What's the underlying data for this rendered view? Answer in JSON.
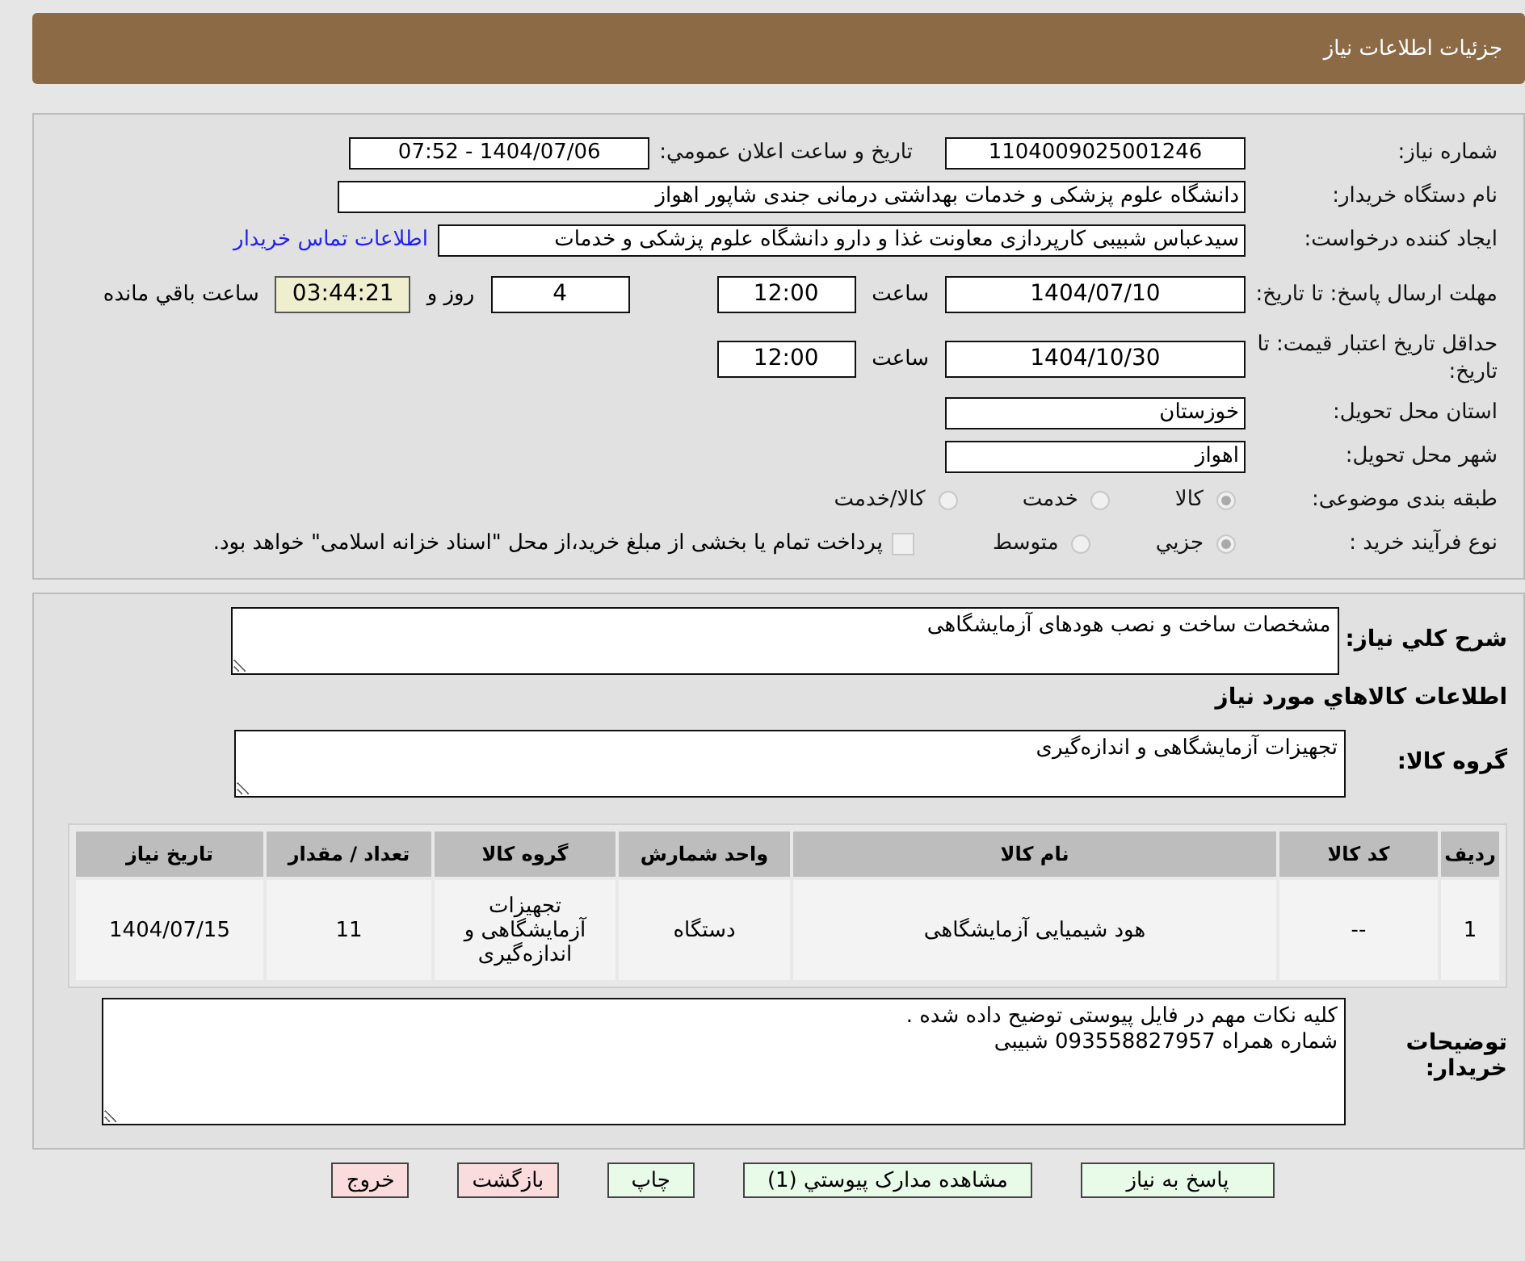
{
  "header": {
    "title": "جزئیات اطلاعات نیاز"
  },
  "details": {
    "need_number": {
      "label": "شماره نیاز:",
      "value": "1104009025001246"
    },
    "announce": {
      "label": "تاریخ و ساعت اعلان عمومي:",
      "value": "1404/07/06 - 07:52"
    },
    "buyer": {
      "label": "نام دستگاه خریدار:",
      "value": "دانشگاه علوم پزشکی و خدمات بهداشتی درمانی جندی شاپور اهواز"
    },
    "requester": {
      "label": "ایجاد کننده درخواست:",
      "value": "سیدعباس شبیبی کارپردازی معاونت غذا و دارو دانشگاه علوم پزشکی و خدمات",
      "link": "اطلاعات تماس خریدار"
    },
    "deadline": {
      "label": "مهلت ارسال پاسخ: تا تاریخ:",
      "date": "1404/07/10",
      "time_label": "ساعت",
      "time": "12:00",
      "days": "4",
      "days_label": "روز و",
      "remaining": "03:44:21",
      "remaining_label": "ساعت باقي مانده"
    },
    "validity": {
      "label": "حداقل تاریخ اعتبار قیمت: تا تاریخ:",
      "date": "1404/10/30",
      "time_label": "ساعت",
      "time": "12:00"
    },
    "province": {
      "label": "استان محل تحویل:",
      "value": "خوزستان"
    },
    "city": {
      "label": "شهر محل تحویل:",
      "value": "اهواز"
    },
    "category": {
      "label": "طبقه بندی موضوعی:",
      "options": [
        {
          "label": "کالا",
          "selected": true
        },
        {
          "label": "خدمت",
          "selected": false
        },
        {
          "label": "کالا/خدمت",
          "selected": false
        }
      ]
    },
    "process": {
      "label": "نوع فرآیند خرید :",
      "options": [
        {
          "label": "جزيي",
          "selected": true
        },
        {
          "label": "متوسط",
          "selected": false
        }
      ],
      "payment": {
        "label": "پرداخت تمام یا بخشی از مبلغ خرید،از محل \"اسناد خزانه اسلامی\" خواهد بود.",
        "checked": false
      }
    }
  },
  "goods": {
    "description": {
      "label": "شرح کلي نیاز:",
      "value": "مشخصات ساخت و نصب هودهای آزمایشگاهی"
    },
    "heading": "اطلاعات کالاهاي مورد نیاز",
    "group": {
      "label": "گروه کالا:",
      "value": "تجهیزات آزمایشگاهی و اندازه‌گیری"
    },
    "table": {
      "columns": [
        "ردیف",
        "کد کالا",
        "نام کالا",
        "واحد شمارش",
        "گروه کالا",
        "تعداد / مقدار",
        "تاریخ نیاز"
      ],
      "rows": [
        [
          "1",
          "--",
          "هود شیمیایی آزمایشگاهی",
          "دستگاه",
          "تجهیزات آزمایشگاهی و اندازه‌گیری",
          "11",
          "1404/07/15"
        ]
      ]
    },
    "notes": {
      "label": "توضیحات خریدار:",
      "lines": [
        "کلیه نکات مهم در فایل پیوستی توضیح داده شده .",
        "شماره همراه 093558827957 شبیبی"
      ]
    }
  },
  "buttons": [
    {
      "label": "پاسخ به نیاز",
      "kind": "ok"
    },
    {
      "label": "مشاهده مدارک پیوستي (1)",
      "kind": "ok"
    },
    {
      "label": "چاپ",
      "kind": "ok"
    },
    {
      "label": "بازگشت",
      "kind": "danger"
    },
    {
      "label": "خروج",
      "kind": "danger"
    }
  ]
}
